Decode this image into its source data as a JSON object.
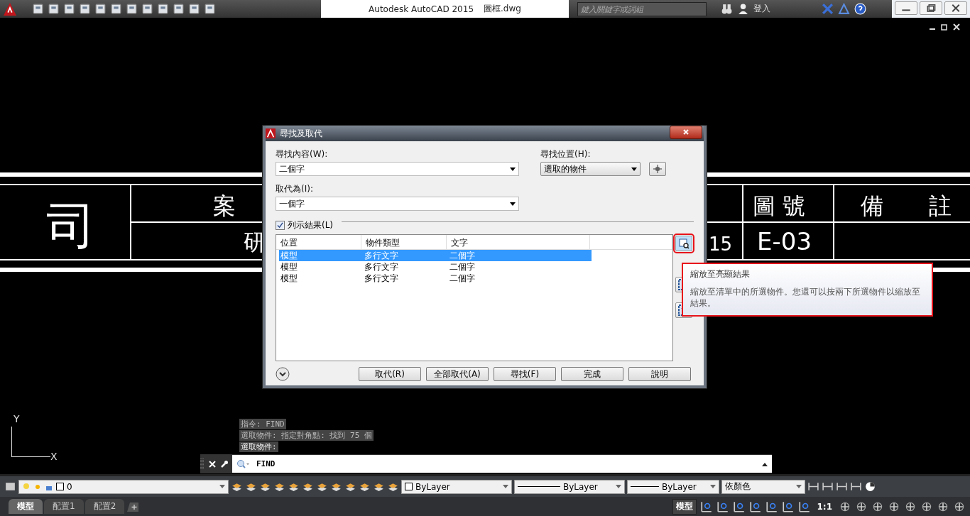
{
  "app_bar": {
    "title": "Autodesk AutoCAD 2015",
    "file": "圖框.dwg",
    "search": {
      "placeholder": "鍵入關鍵字或詞組"
    },
    "sign_in": "登入"
  },
  "drawing": {
    "texts": [
      {
        "kind": "huge",
        "text": "司"
      },
      {
        "kind": "big",
        "text": "案"
      },
      {
        "kind": "big",
        "text": "研"
      },
      {
        "kind": "big",
        "text": "圖 號"
      },
      {
        "kind": "big",
        "text": "備　　註"
      },
      {
        "kind": "num",
        "text": "15"
      },
      {
        "kind": "code",
        "text": "E-03"
      }
    ],
    "ucs": {
      "y": "Y",
      "x": "X"
    }
  },
  "dialog": {
    "title": "尋找及取代",
    "find_label": "尋找內容(W):",
    "find_value": "二個字",
    "location_label": "尋找位置(H):",
    "location_value": "選取的物件",
    "replace_label": "取代為(I):",
    "replace_value": "一個字",
    "list_results": {
      "label": "列示結果(L)",
      "checked": true
    },
    "columns": [
      "位置",
      "物件類型",
      "文字"
    ],
    "rows": [
      {
        "cells": [
          "模型",
          "多行文字",
          "二個字"
        ],
        "selected": true
      },
      {
        "cells": [
          "模型",
          "多行文字",
          "二個字"
        ],
        "selected": false
      },
      {
        "cells": [
          "模型",
          "多行文字",
          "二個字"
        ],
        "selected": false
      }
    ],
    "buttons": [
      "取代(R)",
      "全部取代(A)",
      "尋找(F)",
      "完成",
      "說明"
    ]
  },
  "tooltip": {
    "title": "縮放至亮顯結果",
    "text": "縮放至清單中的所選物件。您還可以按兩下所選物件以縮放至結果。"
  },
  "command_history": [
    "指令: FIND",
    "選取物件: 指定對角點: 找到 75 個",
    "選取物件:"
  ],
  "command_line": {
    "value": "FIND"
  },
  "properties": {
    "layer": "0",
    "color_setting": "ByLayer",
    "linetype": "ByLayer",
    "lineweight": "ByLayer",
    "plot_style": "依顏色"
  },
  "layout_tabs": [
    {
      "label": "模型",
      "selected": true
    },
    {
      "label": "配置1",
      "selected": false
    },
    {
      "label": "配置2",
      "selected": false
    }
  ],
  "status_bar": {
    "space": "模型",
    "scale": "1:1"
  }
}
